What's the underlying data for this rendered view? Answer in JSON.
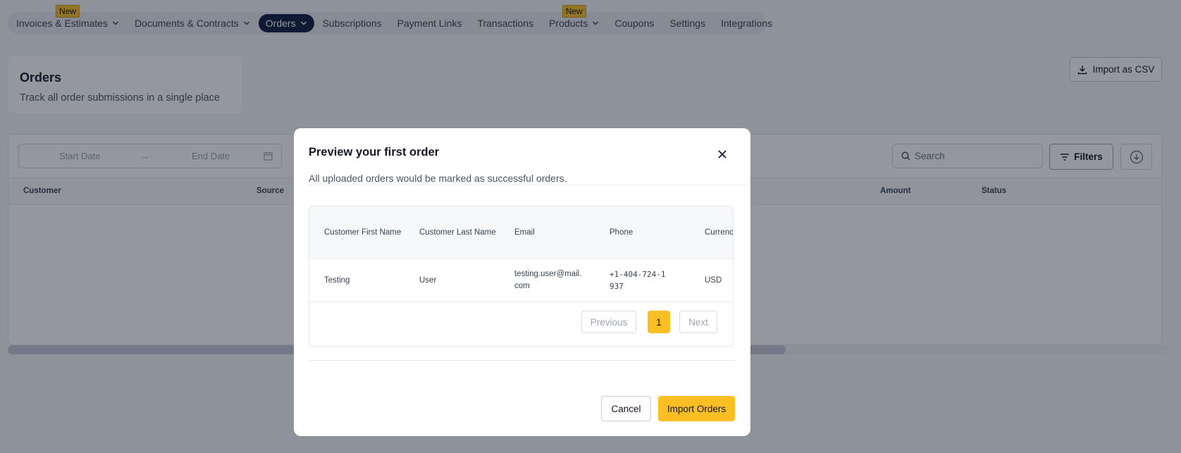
{
  "nav": {
    "items": [
      {
        "label": "Invoices & Estimates",
        "dropdown": true,
        "badge": "New"
      },
      {
        "label": "Documents & Contracts",
        "dropdown": true
      },
      {
        "label": "Orders",
        "dropdown": true,
        "active": true
      },
      {
        "label": "Subscriptions"
      },
      {
        "label": "Payment Links"
      },
      {
        "label": "Transactions"
      },
      {
        "label": "Products",
        "dropdown": true,
        "badge": "New"
      },
      {
        "label": "Coupons"
      },
      {
        "label": "Settings"
      },
      {
        "label": "Integrations"
      }
    ]
  },
  "page": {
    "title": "Orders",
    "subtitle": "Track all order submissions in a single place",
    "import_csv_label": "Import as CSV"
  },
  "filters": {
    "start_date_placeholder": "Start Date",
    "end_date_placeholder": "End Date",
    "search_placeholder": "Search",
    "filters_label": "Filters"
  },
  "list": {
    "columns": [
      "Customer",
      "Source",
      "Amount",
      "Status"
    ]
  },
  "modal": {
    "title": "Preview your first order",
    "subtitle": "All uploaded orders would be marked as successful orders.",
    "table": {
      "columns": [
        "Customer First Name",
        "Customer Last Name",
        "Email",
        "Phone",
        "Currenc"
      ],
      "rows": [
        [
          "Testing",
          "User",
          "testing.user@mail.com",
          "+1-404-724-1937",
          "USD"
        ]
      ]
    },
    "pagination": {
      "previous_label": "Previous",
      "current_page": "1",
      "next_label": "Next"
    },
    "cancel_label": "Cancel",
    "import_label": "Import Orders"
  },
  "colors": {
    "accent": "#fbbf24",
    "nav_active": "#0f1b3d"
  }
}
